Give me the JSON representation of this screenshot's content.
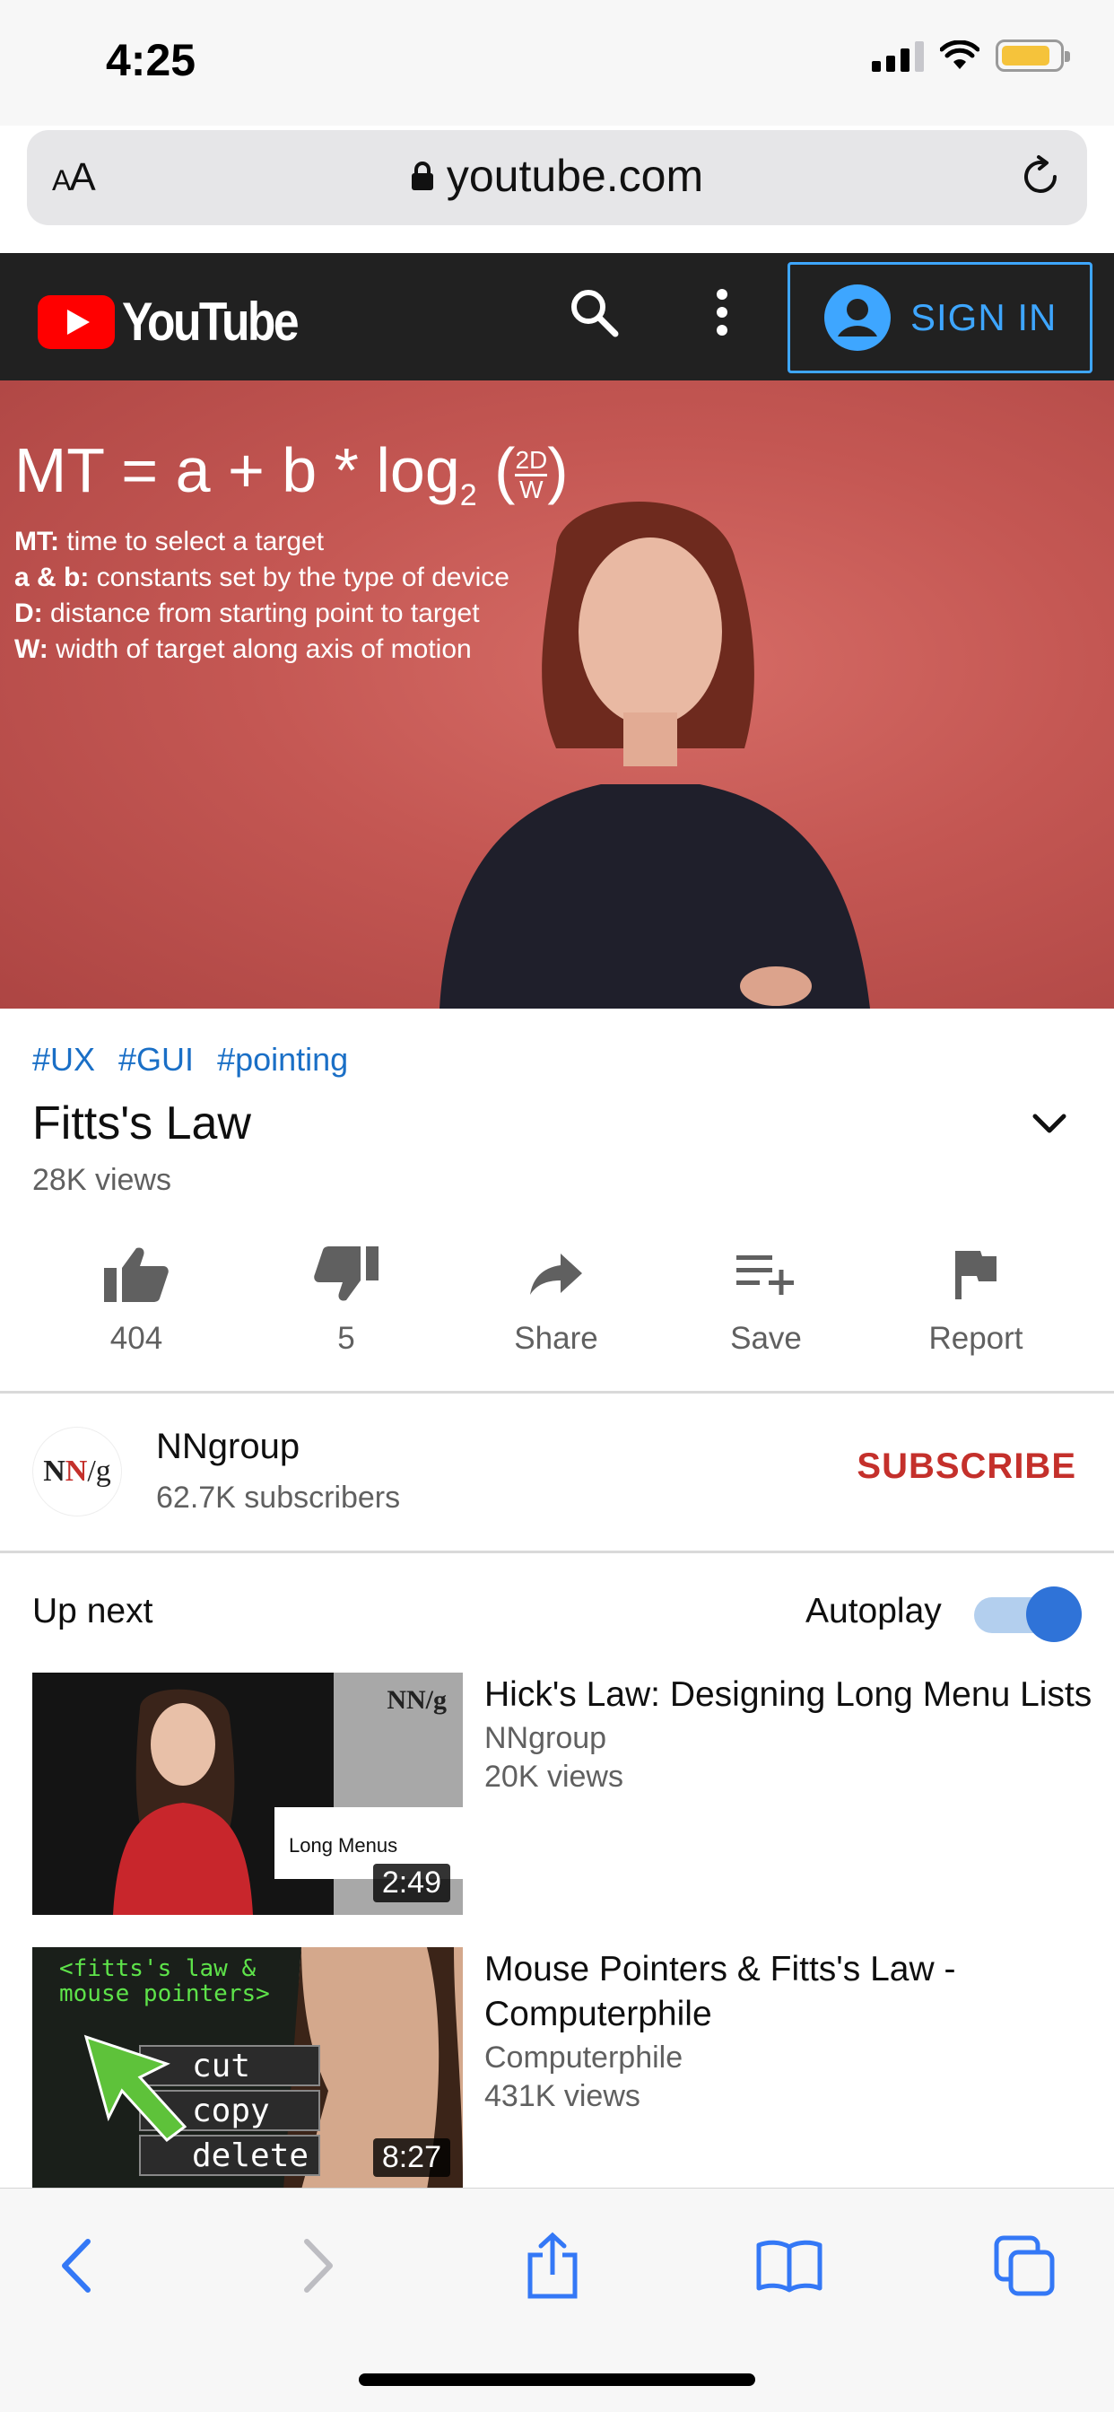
{
  "status_bar": {
    "time": "4:25"
  },
  "browser": {
    "text_size_label": "AA",
    "url": "youtube.com"
  },
  "yt_header": {
    "logo_text": "YouTube",
    "sign_in_label": "SIGN IN"
  },
  "player": {
    "formula_text": "MT = a + b * log",
    "formula_sub": "2",
    "formula_frac_top": "2D",
    "formula_frac_bottom": "W",
    "defs": [
      {
        "term": "MT:",
        "text": " time to select a target"
      },
      {
        "term": "a & b:",
        "text": " constants set by the type of device"
      },
      {
        "term": "D:",
        "text": " distance from starting point to target"
      },
      {
        "term": "W:",
        "text": " width of target along axis of motion"
      }
    ]
  },
  "video": {
    "tags": [
      "#UX",
      "#GUI",
      "#pointing"
    ],
    "title": "Fitts's Law",
    "views": "28K views"
  },
  "actions": {
    "like_count": "404",
    "dislike_count": "5",
    "share_label": "Share",
    "save_label": "Save",
    "report_label": "Report"
  },
  "channel": {
    "avatar_text_1": "N",
    "avatar_text_2": "N",
    "avatar_text_3": "/g",
    "name": "NNgroup",
    "subscribers": "62.7K subscribers",
    "subscribe_label": "SUBSCRIBE"
  },
  "up_next": {
    "label": "Up next",
    "autoplay_label": "Autoplay",
    "autoplay_on": true,
    "items": [
      {
        "title": "Hick's Law: Designing Long Menu Lists",
        "channel": "NNgroup",
        "views": "20K views",
        "duration": "2:49",
        "thumb_logo": "NN/g",
        "thumb_caption": "Long Menus"
      },
      {
        "title": "Mouse Pointers & Fitts's Law - Computerphile",
        "channel": "Computerphile",
        "views": "431K views",
        "duration": "8:27",
        "thumb_text_1": "<fitts's law &",
        "thumb_text_2": "mouse pointers>",
        "thumb_menu": [
          "cut",
          "copy",
          "delete"
        ]
      }
    ]
  },
  "colors": {
    "yt_red": "#ff0000",
    "header_bg": "#212121",
    "link_blue": "#1a6fc6",
    "signin_blue": "#3ea6ff",
    "subscribe_red": "#c4302b",
    "safari_blue": "#3478f6"
  }
}
